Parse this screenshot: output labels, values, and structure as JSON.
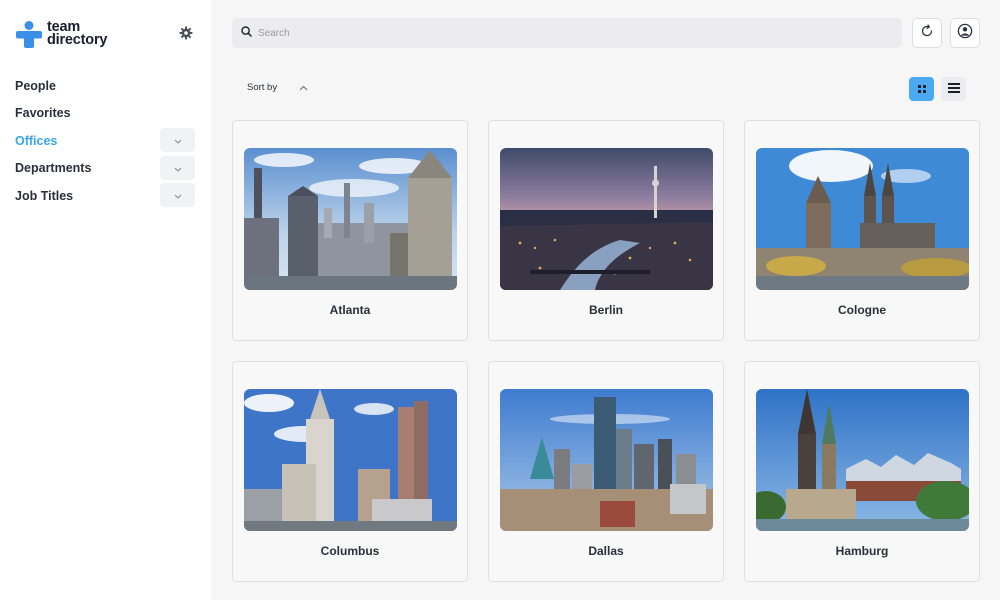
{
  "app": {
    "title_line1": "team",
    "title_line2": "directory",
    "logo_color": "#3a8fe6",
    "settings_icon": "gear-icon"
  },
  "sidebar": {
    "items": [
      {
        "label": "People",
        "active": false,
        "expandable": false
      },
      {
        "label": "Favorites",
        "active": false,
        "expandable": false
      },
      {
        "label": "Offices",
        "active": true,
        "expandable": true
      },
      {
        "label": "Departments",
        "active": false,
        "expandable": true
      },
      {
        "label": "Job Titles",
        "active": false,
        "expandable": true
      }
    ],
    "active_color": "#3aa6ea"
  },
  "header": {
    "search_placeholder": "Search",
    "search_icon": "search-icon",
    "refresh_icon": "refresh-icon",
    "account_icon": "account-icon"
  },
  "toolbar": {
    "sort_label": "Sort by",
    "sort_icon": "chevron-up-icon",
    "view_modes": [
      "grid",
      "list"
    ],
    "active_view": "grid",
    "accent_color": "#4aa9f0"
  },
  "offices": [
    {
      "name": "Atlanta"
    },
    {
      "name": "Berlin"
    },
    {
      "name": "Cologne"
    },
    {
      "name": "Columbus"
    },
    {
      "name": "Dallas"
    },
    {
      "name": "Hamburg"
    }
  ]
}
